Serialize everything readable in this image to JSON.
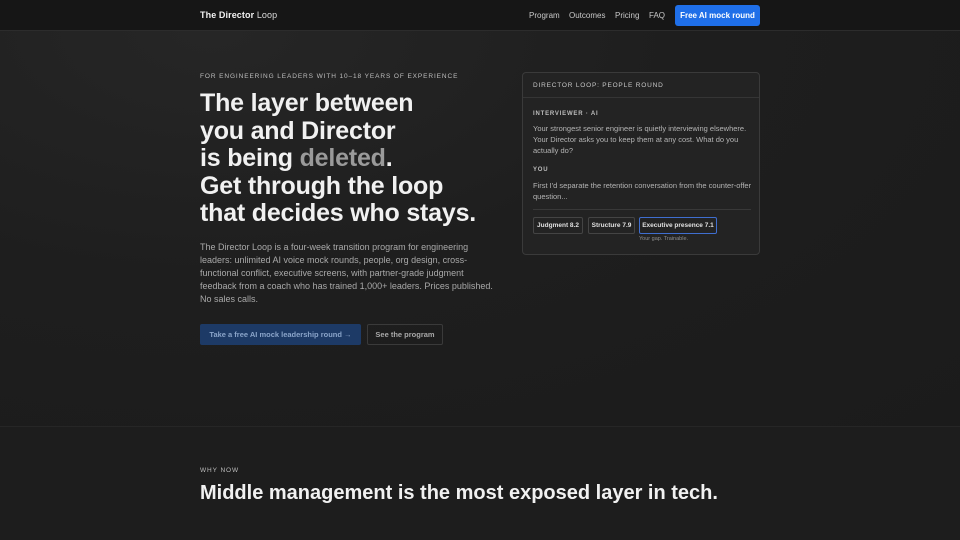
{
  "nav": {
    "brand_bold": "The Director",
    "brand_light": "Loop",
    "links": [
      "Program",
      "Outcomes",
      "Pricing",
      "FAQ"
    ],
    "cta": "Free AI mock round",
    "accent": "#1f6fe8"
  },
  "hero": {
    "eyebrow": "FOR ENGINEERING LEADERS WITH 10–18 YEARS OF EXPERIENCE",
    "headline": {
      "line1": "The layer between",
      "line2": "you and Director",
      "line3_pre": "is being ",
      "line3_muted": "deleted",
      "line3_post": ".",
      "line4": "Get through the loop",
      "line5": "that decides who stays."
    },
    "body": "The Director Loop is a four-week transition program for engineering leaders: unlimited AI voice mock rounds, people, org design, cross-functional conflict, executive screens, with partner-grade judgment feedback from a coach who has trained 1,000+ leaders. Prices published. No sales calls.",
    "primary_cta": "Take a free AI mock leadership round →",
    "secondary_cta": "See the program"
  },
  "card": {
    "title": "DIRECTOR LOOP: PEOPLE ROUND",
    "interviewer_label": "INTERVIEWER · AI",
    "interviewer_msg": "Your strongest senior engineer is quietly interviewing elsewhere. Your Director asks you to keep them at any cost. What do you actually do?",
    "you_label": "YOU",
    "you_msg": "First I'd separate the retention conversation from the counter-offer question...",
    "scores": [
      "Judgment 8.2",
      "Structure 7.9",
      "Executive presence 7.1"
    ],
    "gap_note": "Your gap. Trainable."
  },
  "why_now": {
    "label": "WHY NOW",
    "title": "Middle management is the most exposed layer in tech."
  }
}
